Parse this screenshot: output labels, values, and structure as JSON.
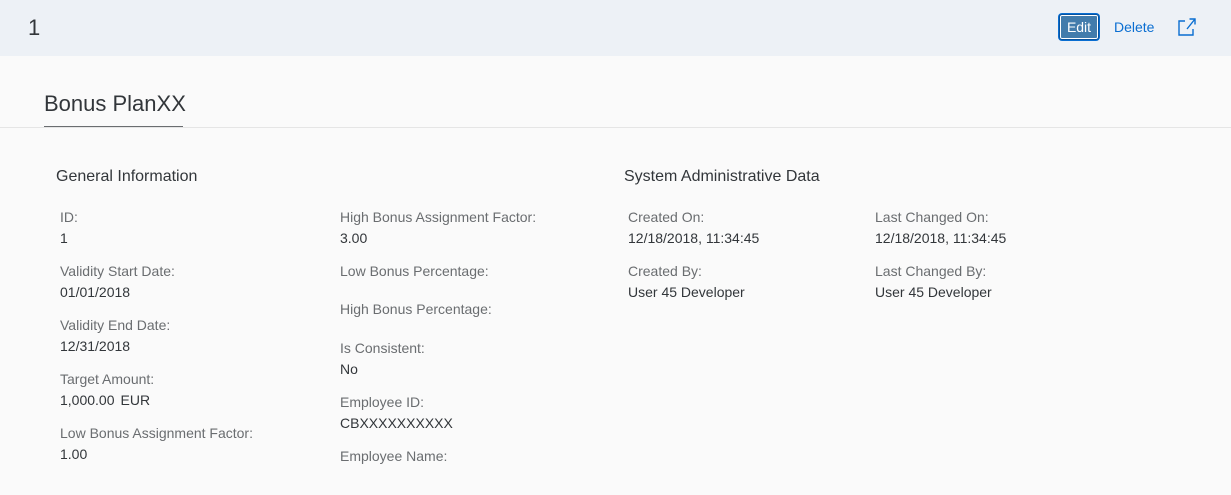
{
  "header": {
    "object_id": "1",
    "edit_label": "Edit",
    "delete_label": "Delete",
    "share_icon": "share-icon",
    "accent": "#0a6ed1"
  },
  "section": {
    "tab_title": "Bonus PlanXX"
  },
  "general_information": {
    "title": "General Information",
    "id": {
      "label": "ID:",
      "value": "1"
    },
    "validity_start": {
      "label": "Validity Start Date:",
      "value": "01/01/2018"
    },
    "validity_end": {
      "label": "Validity End Date:",
      "value": "12/31/2018"
    },
    "target_amount": {
      "label": "Target Amount:",
      "value": "1,000.00",
      "unit": "EUR"
    },
    "low_bonus_factor": {
      "label": "Low Bonus Assignment Factor:",
      "value": "1.00"
    },
    "high_bonus_factor": {
      "label": "High Bonus Assignment Factor:",
      "value": "3.00"
    },
    "low_bonus_percentage": {
      "label": "Low Bonus Percentage:",
      "value": ""
    },
    "high_bonus_percentage": {
      "label": "High Bonus Percentage:",
      "value": ""
    },
    "is_consistent": {
      "label": "Is Consistent:",
      "value": "No"
    },
    "employee_id": {
      "label": "Employee ID:",
      "value": "CBXXXXXXXXXX"
    },
    "employee_name": {
      "label": "Employee Name:",
      "value": ""
    }
  },
  "system_admin": {
    "title": "System Administrative Data",
    "created_on": {
      "label": "Created On:",
      "value": "12/18/2018, 11:34:45"
    },
    "created_by": {
      "label": "Created By:",
      "value": "User 45 Developer"
    },
    "last_changed_on": {
      "label": "Last Changed On:",
      "value": "12/18/2018, 11:34:45"
    },
    "last_changed_by": {
      "label": "Last Changed By:",
      "value": "User 45 Developer"
    }
  }
}
